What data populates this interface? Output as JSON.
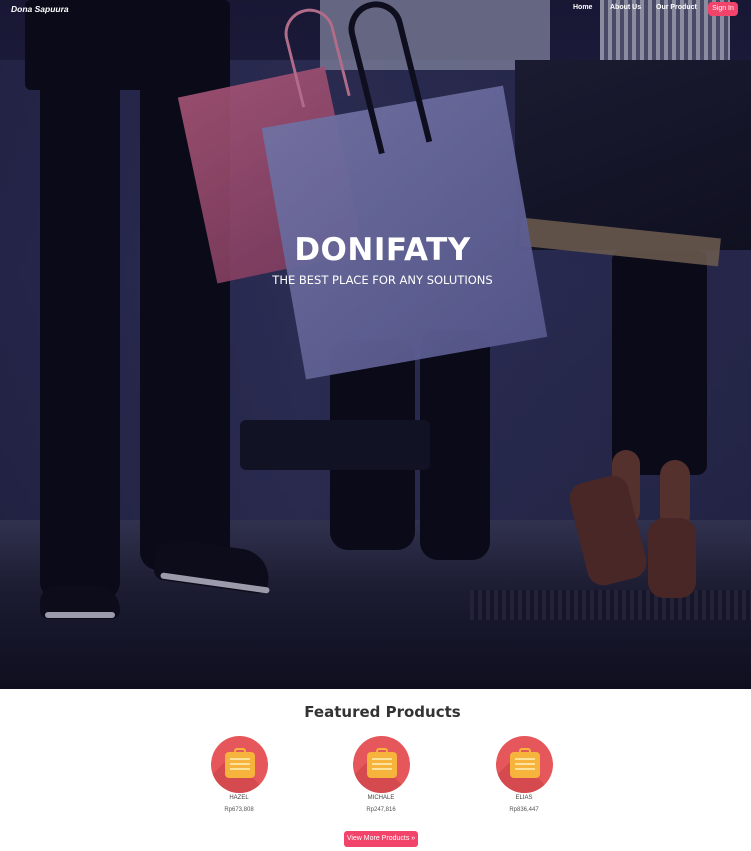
{
  "nav": {
    "brand": "Dona Sapuura",
    "links": [
      {
        "label": "Home"
      },
      {
        "label": "About Us"
      },
      {
        "label": "Our Product"
      }
    ],
    "signin_label": "Sign In"
  },
  "hero": {
    "title": "DONIFATY",
    "subtitle": "THE BEST PLACE FOR ANY SOLUTIONS"
  },
  "featured": {
    "title": "Featured Products",
    "products": [
      {
        "name": "HAZEL",
        "price": "Rp673,808",
        "icon": "suitcase-icon"
      },
      {
        "name": "MICHALE",
        "price": "Rp247,816",
        "icon": "suitcase-icon"
      },
      {
        "name": "ELIAS",
        "price": "Rp836,447",
        "icon": "suitcase-icon"
      }
    ],
    "view_more_label": "View More Products »"
  },
  "colors": {
    "accent": "#f2446b",
    "icon_circle": "#e5575a",
    "icon_suitcase": "#f6b43d"
  }
}
